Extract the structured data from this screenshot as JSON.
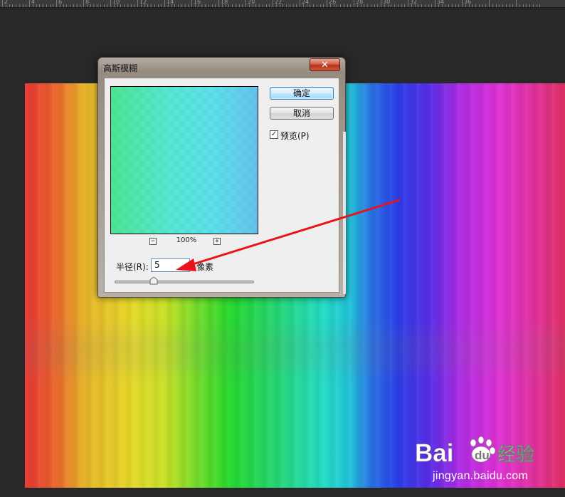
{
  "ruler": {
    "labels": [
      "2",
      "4",
      "6",
      "8",
      "10",
      "12",
      "14",
      "16",
      "18",
      "20",
      "22",
      "24",
      "26",
      "28",
      "30",
      "32",
      "34",
      "36"
    ]
  },
  "dialog": {
    "title": "高斯模糊",
    "close_icon": "✕",
    "ok_label": "确定",
    "cancel_label": "取消",
    "preview_checked": true,
    "preview_check_mark": "✓",
    "preview_label": "预览(P)",
    "zoom_out": "−",
    "zoom_in": "+",
    "zoom_level": "100%",
    "radius_label": "半径(R):",
    "radius_value": "5",
    "unit_label": "像素",
    "slider_level": 0.28
  },
  "watermark": {
    "logo_text_1": "Bai",
    "logo_text_2": "du",
    "logo_text_3": "经验",
    "url": "jingyan.baidu.com"
  },
  "colors": {
    "arrow": "#e8141a",
    "ok_button_border": "#3c7fb1",
    "close_button": "#c8472d"
  },
  "icons": {
    "close": "close-icon",
    "check": "checkbox-check-icon",
    "zoom_out": "zoom-out-icon",
    "zoom_in": "zoom-in-icon",
    "arrow": "annotation-arrow-icon"
  }
}
